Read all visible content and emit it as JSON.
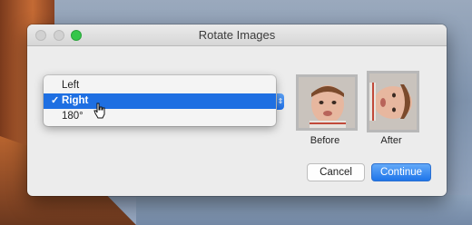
{
  "window": {
    "title": "Rotate Images"
  },
  "menu": {
    "items": [
      {
        "label": "Left",
        "selected": false
      },
      {
        "label": "Right",
        "selected": true,
        "check": "✓"
      },
      {
        "label": "180°",
        "selected": false
      }
    ]
  },
  "preview": {
    "before_label": "Before",
    "after_label": "After"
  },
  "buttons": {
    "cancel": "Cancel",
    "continue": "Continue"
  },
  "colors": {
    "accent": "#1e6fe2",
    "zoom_green": "#35c64a"
  }
}
